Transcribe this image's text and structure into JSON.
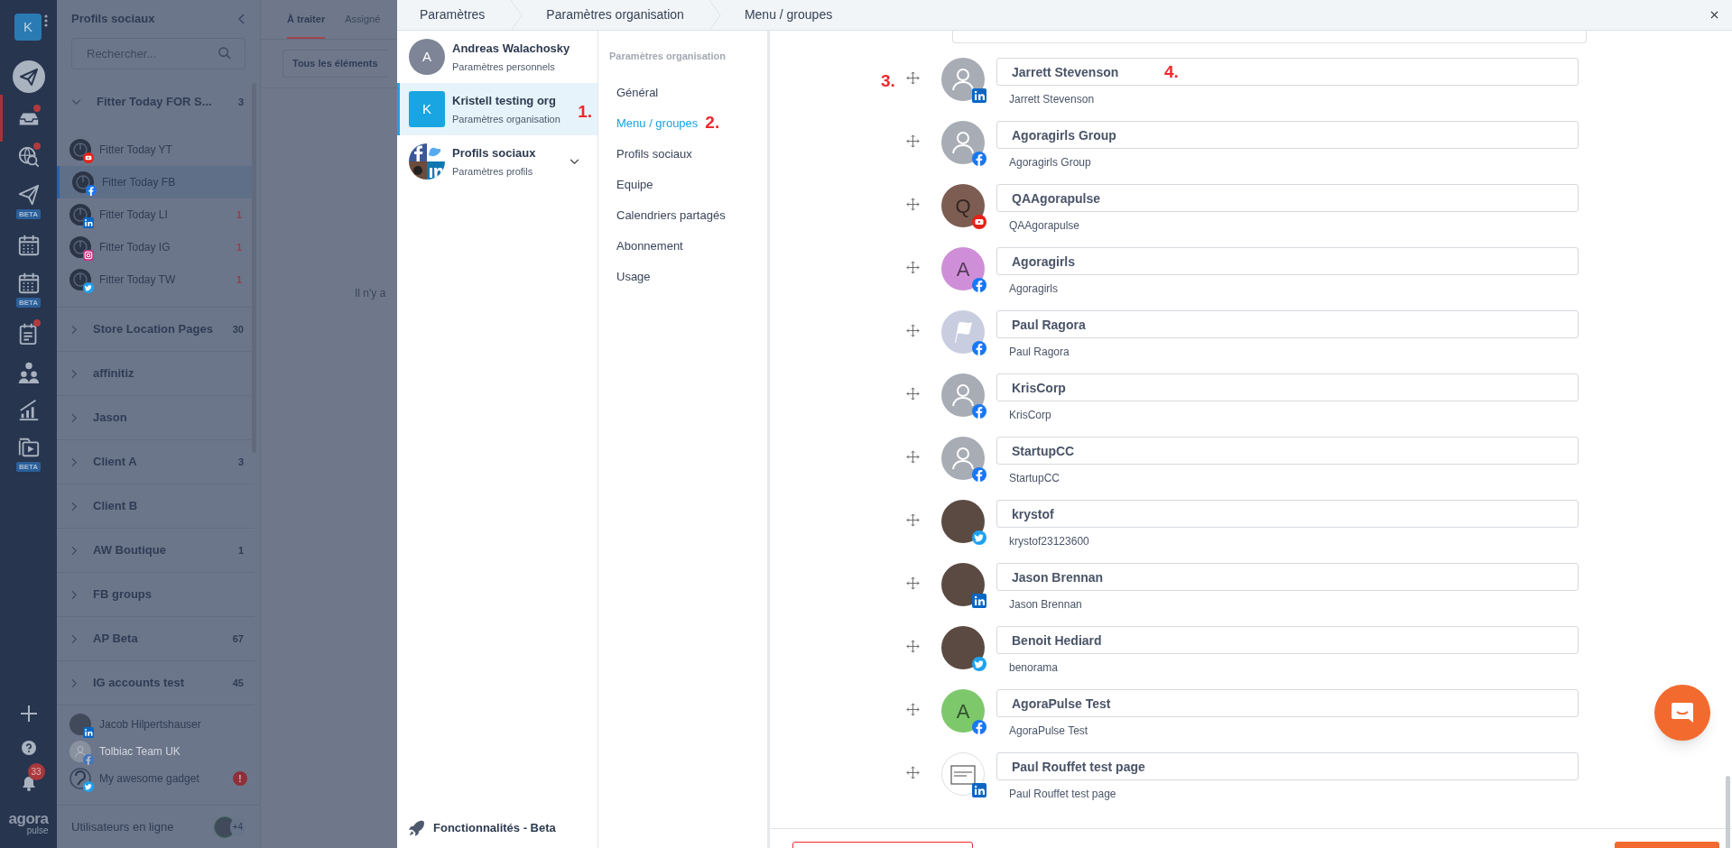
{
  "rail": {
    "logo_letter": "K",
    "items": [
      {
        "kind": "plane-circle",
        "selected": false,
        "dot": false
      },
      {
        "kind": "inbox",
        "selected": true,
        "dot": true
      },
      {
        "kind": "globe-search",
        "selected": false,
        "dot": true
      },
      {
        "kind": "plane",
        "selected": false,
        "dot": false,
        "badge": "BETA"
      },
      {
        "kind": "calendar",
        "selected": false,
        "dot": false
      },
      {
        "kind": "calendar",
        "selected": false,
        "dot": false,
        "badge": "BETA"
      },
      {
        "kind": "notes",
        "selected": false,
        "dot": true
      },
      {
        "kind": "people",
        "selected": false,
        "dot": false
      },
      {
        "kind": "chart",
        "selected": false,
        "dot": false
      },
      {
        "kind": "video",
        "selected": false,
        "dot": false,
        "badge": "BETA"
      }
    ],
    "bottom": [
      {
        "kind": "plus"
      },
      {
        "kind": "help"
      },
      {
        "kind": "bell",
        "count": "33"
      }
    ],
    "brand": {
      "top": "agora",
      "bottom": "pulse"
    }
  },
  "sidebar": {
    "title": "Profils sociaux",
    "search": {
      "placeholder": "Rechercher..."
    },
    "groups": [
      {
        "label": "Fitter Today FOR S...",
        "count": "3",
        "expanded": true,
        "children": [
          {
            "label": "Fitter Today YT",
            "badge": {
              "kind": "youtube"
            },
            "selected": false
          },
          {
            "label": "Fitter Today FB",
            "badge": {
              "kind": "facebook"
            },
            "selected": true
          },
          {
            "label": "Fitter Today LI",
            "badge": {
              "kind": "linkedin"
            },
            "selected": false,
            "count": "1"
          },
          {
            "label": "Fitter Today IG",
            "badge": {
              "kind": "instagram"
            },
            "selected": false,
            "count": "1"
          },
          {
            "label": "Fitter Today TW",
            "badge": {
              "kind": "twitter"
            },
            "selected": false,
            "count": "1"
          }
        ]
      },
      {
        "label": "Store Location Pages",
        "count": "30",
        "expanded": false
      },
      {
        "label": "affinitiz",
        "expanded": false
      },
      {
        "label": "Jason",
        "expanded": false
      },
      {
        "label": "Client A",
        "count": "3",
        "expanded": false
      },
      {
        "label": "Client B",
        "expanded": false
      },
      {
        "label": "AW Boutique",
        "count": "1",
        "expanded": false
      },
      {
        "label": "FB groups",
        "expanded": false
      },
      {
        "label": "AP Beta",
        "count": "67",
        "expanded": false
      },
      {
        "label": "IG accounts test",
        "count": "45",
        "expanded": false
      }
    ],
    "profiles": [
      {
        "label": "Jacob Hilpertshauser",
        "badge": {
          "kind": "linkedin"
        },
        "avatar": {
          "kind": "photo"
        },
        "disabled": false
      },
      {
        "label": "Tolbiac Team UK",
        "badge": {
          "kind": "facebook"
        },
        "avatar": {
          "kind": "default"
        },
        "disabled": true
      },
      {
        "label": "My awesome gadget",
        "badge": {
          "kind": "twitter"
        },
        "avatar": {
          "kind": "logo"
        },
        "disabled": false,
        "alert": "!"
      }
    ],
    "footer": {
      "label": "Utilisateurs en ligne",
      "extra": "+4"
    }
  },
  "main": {
    "tabs": [
      {
        "label": "À traiter",
        "selected": true
      },
      {
        "label": "Assigné",
        "selected": false
      }
    ],
    "filter": "Tous les éléments",
    "empty": "Il n'y a"
  },
  "modal": {
    "breadcrumbs": [
      "Paramètres",
      "Paramètres organisation",
      "Menu / groupes"
    ],
    "accounts": [
      {
        "name": "Andreas Walachosky",
        "subtitle": "Paramètres personnels",
        "avatar": {
          "kind": "letter",
          "letter": "A"
        },
        "selected": false
      },
      {
        "name": "Kristell testing org",
        "subtitle": "Paramètres organisation",
        "avatar": {
          "kind": "square",
          "letter": "K"
        },
        "selected": true,
        "annotation": "1."
      },
      {
        "name": "Profils sociaux",
        "subtitle": "Paramètres profils",
        "avatar": {
          "kind": "collage"
        },
        "selected": false,
        "expandable": true
      }
    ],
    "beta_link": "Fonctionnalités - Beta",
    "menu": {
      "heading": "Paramètres organisation",
      "items": [
        {
          "label": "Général",
          "selected": false
        },
        {
          "label": "Menu / groupes",
          "selected": true,
          "annotation": "2."
        },
        {
          "label": "Profils sociaux",
          "selected": false
        },
        {
          "label": "Equipe",
          "selected": false
        },
        {
          "label": "Calendriers partagés",
          "selected": false
        },
        {
          "label": "Abonnement",
          "selected": false
        },
        {
          "label": "Usage",
          "selected": false
        }
      ]
    },
    "profiles": [
      {
        "name": "Jarrett Stevenson",
        "handle": "Jarrett Stevenson",
        "badge": {
          "kind": "linkedin"
        },
        "avatar": {
          "kind": "default"
        },
        "drag_annotation": "3.",
        "annotation": "4."
      },
      {
        "name": "Agoragirls Group",
        "handle": "Agoragirls Group",
        "badge": {
          "kind": "facebook"
        },
        "avatar": {
          "kind": "default"
        }
      },
      {
        "name": "QAAgorapulse",
        "handle": "QAAgorapulse",
        "badge": {
          "kind": "youtube"
        },
        "avatar": {
          "kind": "letter",
          "letter": "Q",
          "color": "#7d5c52"
        }
      },
      {
        "name": "Agoragirls",
        "handle": "Agoragirls",
        "badge": {
          "kind": "facebook"
        },
        "avatar": {
          "kind": "letter",
          "letter": "A",
          "color": "#cf8fd8"
        }
      },
      {
        "name": "Paul Ragora",
        "handle": "Paul Ragora",
        "badge": {
          "kind": "facebook"
        },
        "avatar": {
          "kind": "flag"
        }
      },
      {
        "name": "KrisCorp",
        "handle": "KrisCorp",
        "badge": {
          "kind": "facebook"
        },
        "avatar": {
          "kind": "default"
        }
      },
      {
        "name": "StartupCC",
        "handle": "StartupCC",
        "badge": {
          "kind": "facebook"
        },
        "avatar": {
          "kind": "default"
        }
      },
      {
        "name": "krystof",
        "handle": "krystof23123600",
        "badge": {
          "kind": "twitter"
        },
        "avatar": {
          "kind": "photo"
        }
      },
      {
        "name": "Jason Brennan",
        "handle": "Jason Brennan",
        "badge": {
          "kind": "linkedin"
        },
        "avatar": {
          "kind": "photo"
        }
      },
      {
        "name": "Benoit Hediard",
        "handle": "benorama",
        "badge": {
          "kind": "twitter"
        },
        "avatar": {
          "kind": "photo"
        }
      },
      {
        "name": "AgoraPulse Test",
        "handle": "AgoraPulse Test",
        "badge": {
          "kind": "facebook"
        },
        "avatar": {
          "kind": "letter",
          "letter": "A",
          "color": "#7dc86b"
        }
      },
      {
        "name": "Paul Rouffet test page",
        "handle": "Paul Rouffet test page",
        "badge": {
          "kind": "linkedin"
        },
        "avatar": {
          "kind": "image"
        }
      }
    ]
  }
}
